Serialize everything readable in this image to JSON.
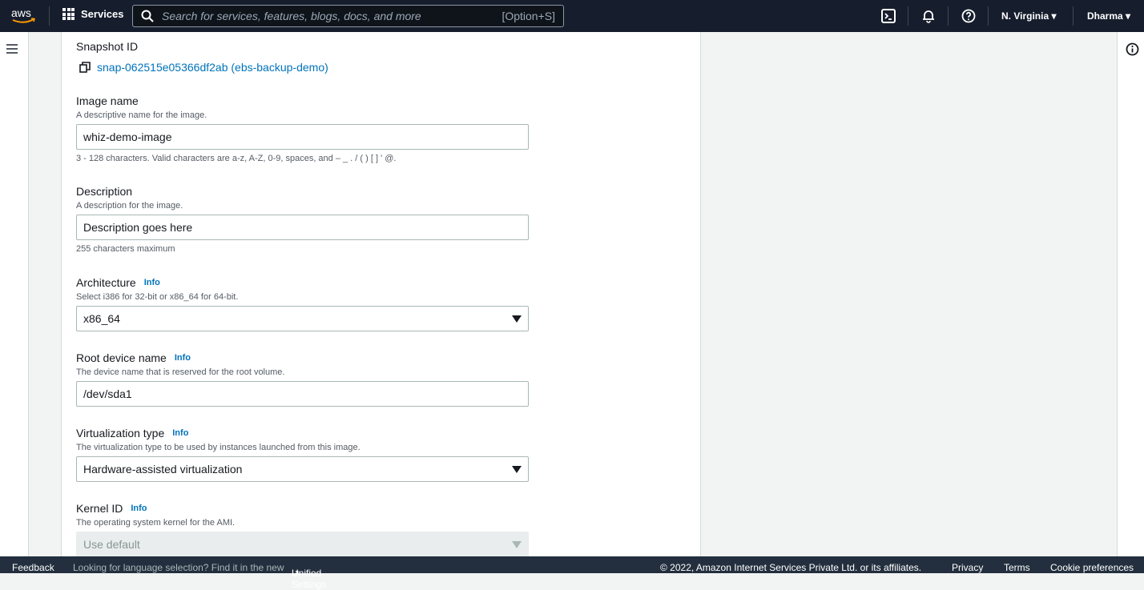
{
  "nav": {
    "services": "Services",
    "search_placeholder": "Search for services, features, blogs, docs, and more",
    "search_shortcut": "[Option+S]",
    "region": "N. Virginia",
    "user": "Dharma"
  },
  "form": {
    "snapshot": {
      "label": "Snapshot ID",
      "value": "snap-062515e05366df2ab (ebs-backup-demo)"
    },
    "image_name": {
      "label": "Image name",
      "desc": "A descriptive name for the image.",
      "value": "whiz-demo-image",
      "hint": "3 - 128 characters. Valid characters are a-z, A-Z, 0-9, spaces, and – _ . / ( ) [ ] ' @."
    },
    "description": {
      "label": "Description",
      "desc": "A description for the image.",
      "value": "Description goes here",
      "hint": "255 characters maximum"
    },
    "architecture": {
      "label": "Architecture",
      "info": "Info",
      "desc": "Select i386 for 32-bit or x86_64 for 64-bit.",
      "value": "x86_64"
    },
    "root_device": {
      "label": "Root device name",
      "info": "Info",
      "desc": "The device name that is reserved for the root volume.",
      "value": "/dev/sda1"
    },
    "virtualization": {
      "label": "Virtualization type",
      "info": "Info",
      "desc": "The virtualization type to be used by instances launched from this image.",
      "value": "Hardware-assisted virtualization"
    },
    "kernel": {
      "label": "Kernel ID",
      "info": "Info",
      "desc": "The operating system kernel for the AMI.",
      "value": "Use default"
    }
  },
  "footer": {
    "feedback": "Feedback",
    "lang_text": "Looking for language selection? Find it in the new",
    "unified": "Unified Settings",
    "copyright": "© 2022, Amazon Internet Services Private Ltd. or its affiliates.",
    "privacy": "Privacy",
    "terms": "Terms",
    "cookies": "Cookie preferences"
  }
}
